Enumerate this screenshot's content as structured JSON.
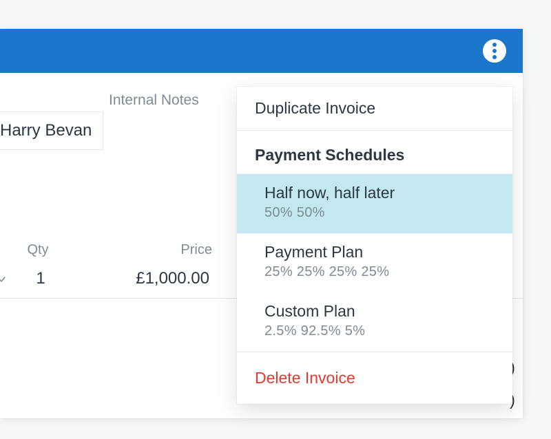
{
  "header": {},
  "fields": {
    "internal_notes_label": "Internal Notes",
    "customer_name": "Harry Bevan"
  },
  "columns": {
    "qty": "Qty",
    "price": "Price"
  },
  "line": {
    "qty": "1",
    "price": "£1,000.00"
  },
  "menu": {
    "duplicate": "Duplicate Invoice",
    "schedules_heading": "Payment Schedules",
    "schedules": [
      {
        "title": "Half now, half later",
        "sub": "50% 50%",
        "selected": true
      },
      {
        "title": "Payment Plan",
        "sub": "25% 25% 25% 25%",
        "selected": false
      },
      {
        "title": "Custom Plan",
        "sub": "2.5%  92.5% 5%",
        "selected": false
      }
    ],
    "delete": "Delete Invoice"
  },
  "decor": {
    "paren1": ")",
    "paren2": ")"
  }
}
